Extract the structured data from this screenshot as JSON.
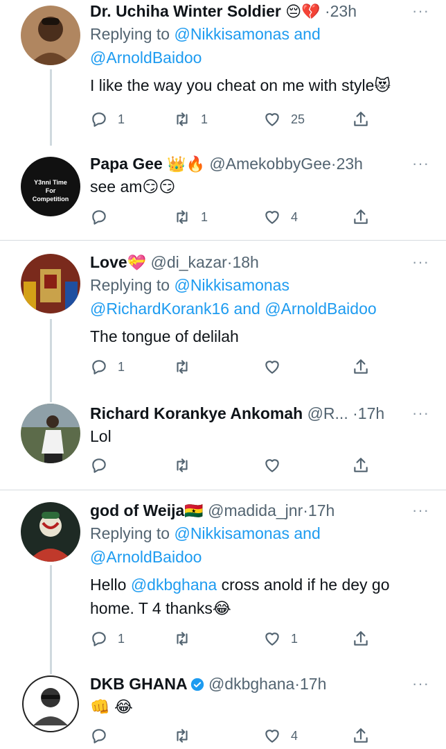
{
  "tweets": [
    {
      "name": "Dr. Uchiha Winter Soldier",
      "name_emoji": "😔💔",
      "handle": "",
      "time": "23h",
      "replying_prefix": "Replying to",
      "mentions_line1": "@Nikkisamonas and",
      "mentions_line2": "@ArnoldBaidoo",
      "text": "I like the way you cheat on me with style😻",
      "replies": "1",
      "retweets": "1",
      "likes": "25"
    },
    {
      "name": "Papa Gee",
      "name_emoji": "👑🔥",
      "handle": "@AmekobbyGee",
      "time": "23h",
      "avatar_text": [
        "Y3nni Time",
        "For",
        "Competition"
      ],
      "text": "see am😏😏",
      "replies": "",
      "retweets": "1",
      "likes": "4"
    },
    {
      "name": "Love",
      "name_emoji": "💝",
      "handle": "@di_kazar",
      "time": "18h",
      "replying_prefix": "Replying to",
      "mentions_line1": "@Nikkisamonas",
      "mentions_line2": "@RichardKorank16 and @ArnoldBaidoo",
      "text": "The tongue of delilah",
      "replies": "1",
      "retweets": "",
      "likes": ""
    },
    {
      "name": "Richard Korankye Ankomah",
      "handle": "@R...",
      "time": "17h",
      "text": "Lol",
      "replies": "",
      "retweets": "",
      "likes": ""
    },
    {
      "name": "god of Weija",
      "name_emoji": "🇬🇭",
      "handle": "@madida_jnr",
      "time": "17h",
      "replying_prefix": "Replying to",
      "mentions_line1": "@Nikkisamonas and",
      "mentions_line2": "@ArnoldBaidoo",
      "text_before": "Hello",
      "text_mention": "@dkbghana",
      "text_after": " cross anold if he dey go",
      "text_line2": "home. T 4 thanks😂",
      "replies": "1",
      "retweets": "",
      "likes": "1"
    },
    {
      "name": "DKB GHANA",
      "handle": "@dkbghana",
      "time": "17h",
      "text": "👊 😂",
      "replies": "",
      "retweets": "",
      "likes": "4"
    }
  ],
  "separator": "·",
  "more_glyph": "···",
  "colors": {
    "link": "#1d9bf0",
    "muted": "#536471",
    "divider": "#d6dbdf"
  }
}
